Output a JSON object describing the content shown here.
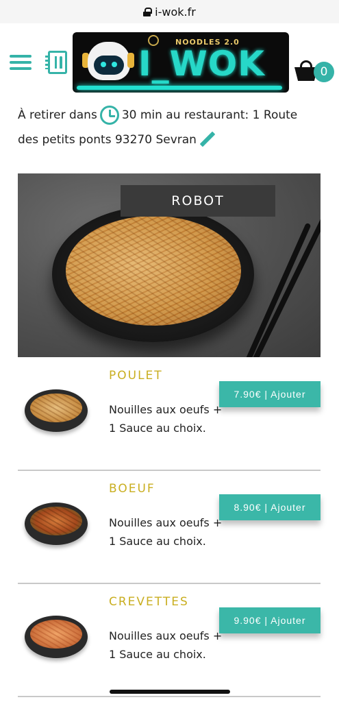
{
  "browser": {
    "url": "i-wok.fr"
  },
  "header": {
    "logo": {
      "tagline": "NOODLES 2.0",
      "word": "I_WOK"
    },
    "cart_count": "0"
  },
  "pickup": {
    "prefix": "À retirer dans",
    "suffix": "30 min au restaurant: 1 Route des petits ponts 93270 Sevran"
  },
  "hero": {
    "label": "ROBOT"
  },
  "menu": {
    "items": [
      {
        "name": "POULET",
        "description": "Nouilles aux oeufs + 1 Sauce au choix.",
        "button": "7.90€ | Ajouter"
      },
      {
        "name": "BOEUF",
        "description": "Nouilles aux oeufs + 1 Sauce au choix.",
        "button": "8.90€ | Ajouter"
      },
      {
        "name": "CREVETTES",
        "description": "Nouilles aux oeufs + 1 Sauce au choix.",
        "button": "9.90€ | Ajouter"
      }
    ]
  },
  "colors": {
    "accent": "#35b3a8",
    "item_title": "#c9ae20",
    "hero_label_bg": "#3a3a3a"
  },
  "icons": [
    "lock-icon",
    "hamburger-menu-icon",
    "menu-book-icon",
    "cart-icon",
    "clock-icon",
    "pencil-edit-icon"
  ]
}
